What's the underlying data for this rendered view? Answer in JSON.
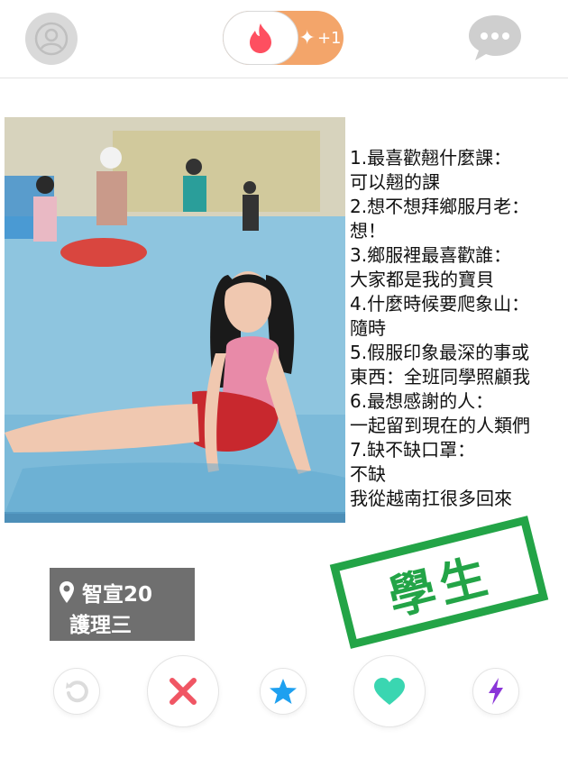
{
  "header": {
    "boost_label": "+1",
    "colors": {
      "brand": "#fe4f60",
      "boost": "#f3a56a",
      "icon_grey": "#cfcfcf"
    }
  },
  "profile": {
    "qa_lines": [
      "1.最喜歡翹什麼課：",
      "可以翹的課",
      "2.想不想拜鄉服月老：",
      "想！",
      "3.鄉服裡最喜歡誰：",
      "大家都是我的寶貝",
      "4.什麼時候要爬象山：",
      "隨時",
      "5.假服印象最深的事或",
      "東西：全班同學照顧我",
      "6.最想感謝的人：",
      "一起留到現在的人類們",
      "7.缺不缺口罩：",
      "不缺",
      "我從越南扛很多回來"
    ],
    "stamp_text": "學生",
    "name_age": "智宣20",
    "department": "護理三"
  },
  "actions": {
    "colors": {
      "rewind": "#dcdcdc",
      "nope": "#f05664",
      "superlike": "#1ea0f0",
      "like": "#3ad6b1",
      "boost": "#8a35d8"
    }
  }
}
